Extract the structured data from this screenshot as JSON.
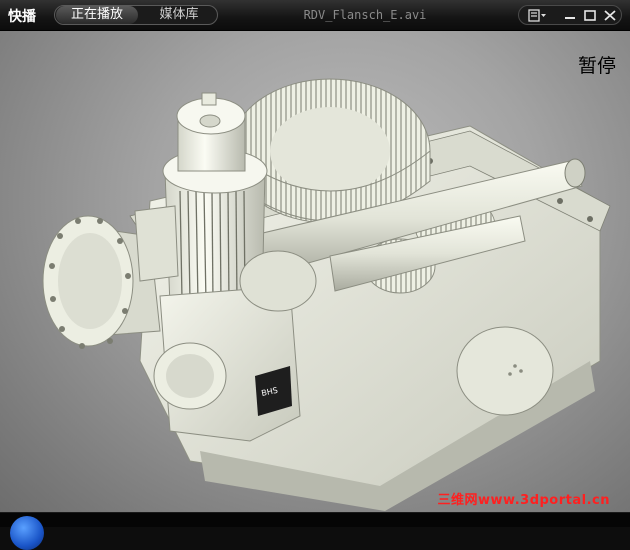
{
  "app": {
    "brand": "快播"
  },
  "tabs": {
    "now_playing": "正在播放",
    "library": "媒体库"
  },
  "window": {
    "title": "RDV_Flansch_E.avi"
  },
  "controls": {
    "menu": "menu-icon",
    "minimize": "minimize-icon",
    "maximize": "maximize-icon",
    "close": "close-icon"
  },
  "player": {
    "status": "暂停"
  },
  "watermark": {
    "text": "三维网www.3dportal.cn",
    "color": "#ff2020"
  },
  "colors": {
    "titlebar": "#1c1c1c",
    "video_bg": "#a3a3a3",
    "model": "#e6e8dc"
  }
}
